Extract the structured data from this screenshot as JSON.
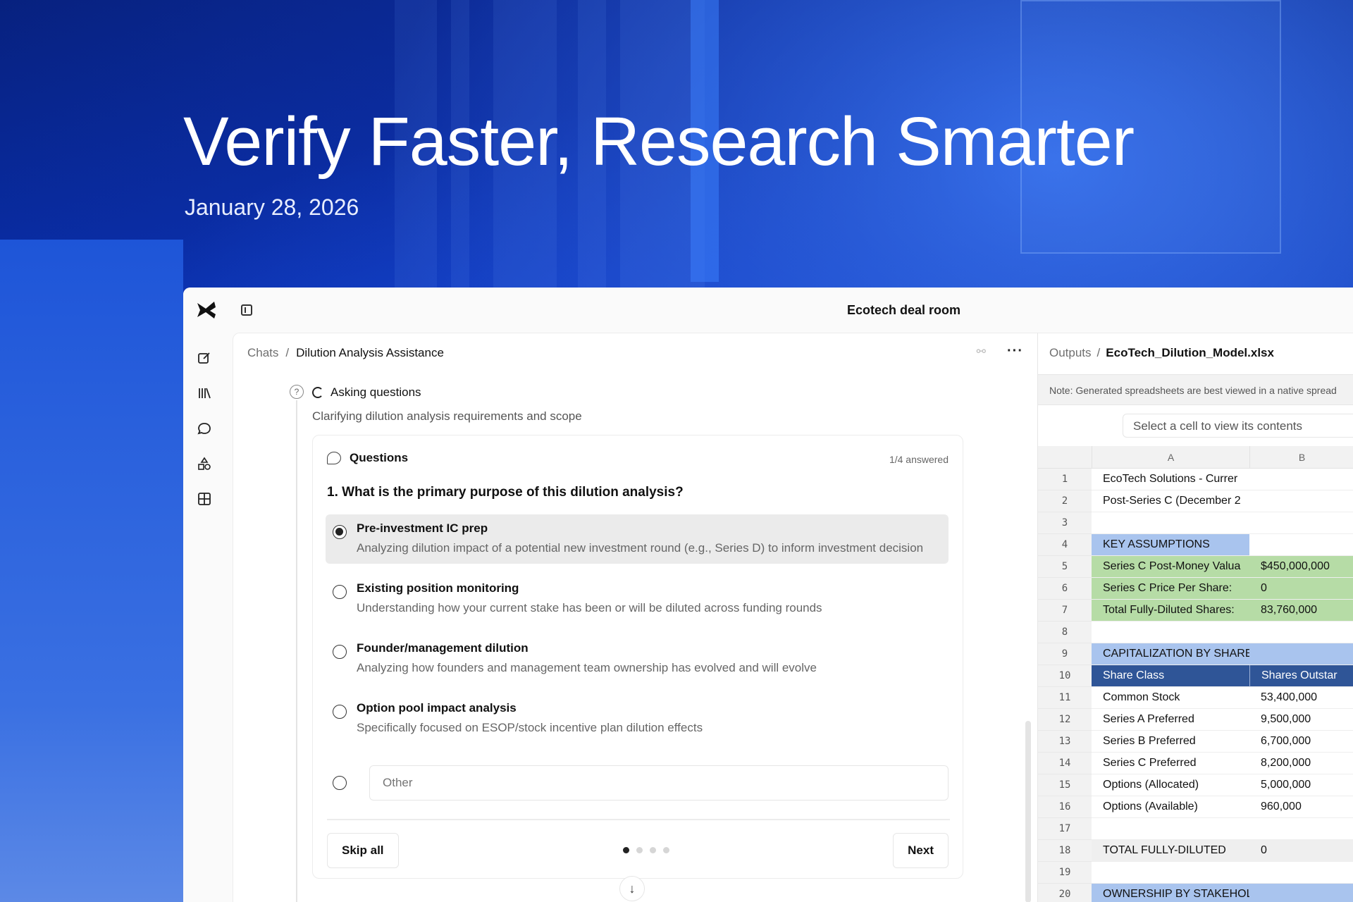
{
  "hero": {
    "title": "Verify Faster, Research Smarter",
    "date": "January 28, 2026"
  },
  "app": {
    "room_title": "Ecotech deal room",
    "rail_icons": [
      "new-chat-icon",
      "library-icon",
      "chat-icon",
      "shapes-icon",
      "table-icon"
    ]
  },
  "chat": {
    "breadcrumb_root": "Chats",
    "breadcrumb_sep": "/",
    "breadcrumb_current": "Dilution Analysis Assistance",
    "status_label": "Asking questions",
    "status_sub": "Clarifying dilution analysis requirements and scope",
    "questions": {
      "heading": "Questions",
      "answered": "1/4 answered",
      "question": "1. What is the primary purpose of this dilution analysis?",
      "options": [
        {
          "title": "Pre-investment IC prep",
          "desc": "Analyzing dilution impact of a potential new investment round (e.g., Series D) to inform investment decision",
          "selected": true
        },
        {
          "title": "Existing position monitoring",
          "desc": "Understanding how your current stake has been or will be diluted across funding rounds",
          "selected": false
        },
        {
          "title": "Founder/management dilution",
          "desc": "Analyzing how founders and management team ownership has evolved and will evolve",
          "selected": false
        },
        {
          "title": "Option pool impact analysis",
          "desc": "Specifically focused on ESOP/stock incentive plan dilution effects",
          "selected": false
        }
      ],
      "other_placeholder": "Other",
      "skip_label": "Skip all",
      "next_label": "Next",
      "page_current": 1,
      "page_total": 4
    }
  },
  "outputs": {
    "breadcrumb_root": "Outputs",
    "breadcrumb_sep": "/",
    "file_name": "EcoTech_Dilution_Model.xlsx",
    "note": "Note: Generated spreadsheets are best viewed in a native spread",
    "cell_viewer_placeholder": "Select a cell to view its contents",
    "columns": [
      "A",
      "B"
    ],
    "rows": [
      {
        "n": "1",
        "a": "EcoTech Solutions - Currer",
        "b": "",
        "style": ""
      },
      {
        "n": "2",
        "a": "Post-Series C (December 2",
        "b": "",
        "style": ""
      },
      {
        "n": "3",
        "a": "",
        "b": "",
        "style": ""
      },
      {
        "n": "4",
        "a": "KEY ASSUMPTIONS",
        "b": "",
        "style": "section-a"
      },
      {
        "n": "5",
        "a": "Series C Post-Money Valua",
        "b": "$450,000,000",
        "style": "green"
      },
      {
        "n": "6",
        "a": "Series C Price Per Share:",
        "b": "0",
        "style": "green"
      },
      {
        "n": "7",
        "a": "Total Fully-Diluted Shares:",
        "b": "83,760,000",
        "style": "green"
      },
      {
        "n": "8",
        "a": "",
        "b": "",
        "style": ""
      },
      {
        "n": "9",
        "a": "CAPITALIZATION BY SHARE CLASS",
        "b": "",
        "style": "section"
      },
      {
        "n": "10",
        "a": "Share Class",
        "b": "Shares Outstar",
        "style": "header"
      },
      {
        "n": "11",
        "a": "Common Stock",
        "b": "53,400,000",
        "style": ""
      },
      {
        "n": "12",
        "a": "Series A Preferred",
        "b": "9,500,000",
        "style": ""
      },
      {
        "n": "13",
        "a": "Series B Preferred",
        "b": "6,700,000",
        "style": ""
      },
      {
        "n": "14",
        "a": "Series C Preferred",
        "b": "8,200,000",
        "style": ""
      },
      {
        "n": "15",
        "a": "Options (Allocated)",
        "b": "5,000,000",
        "style": ""
      },
      {
        "n": "16",
        "a": "Options (Available)",
        "b": "960,000",
        "style": ""
      },
      {
        "n": "17",
        "a": "",
        "b": "",
        "style": ""
      },
      {
        "n": "18",
        "a": "TOTAL FULLY-DILUTED",
        "b": "0",
        "style": "total"
      },
      {
        "n": "19",
        "a": "",
        "b": "",
        "style": ""
      },
      {
        "n": "20",
        "a": "OWNERSHIP BY STAKEHOLDER",
        "b": "",
        "style": "section"
      }
    ]
  }
}
